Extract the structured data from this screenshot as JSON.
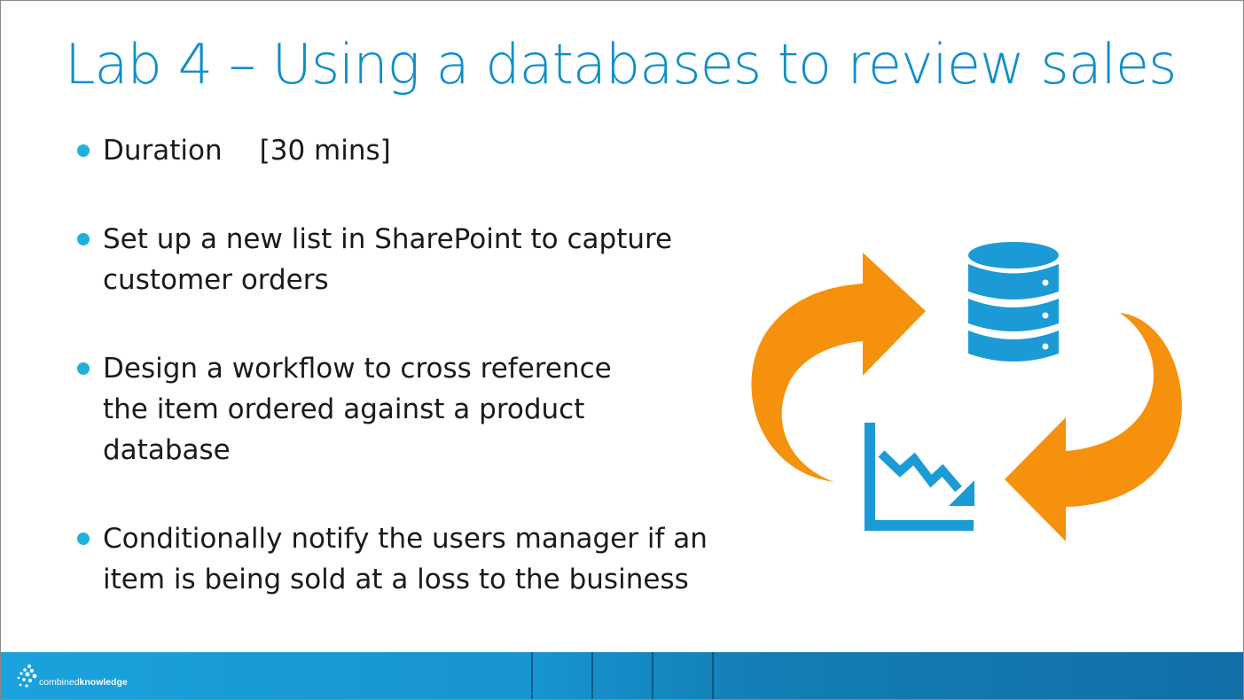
{
  "slide": {
    "title": "Lab 4 – Using a databases to review sales",
    "title_color": "#0e8ec9",
    "bullet_color": "#1fb1d9",
    "bullets": [
      {
        "label": "Duration",
        "value": "[30 mins]"
      },
      {
        "text": "Set up a new list in SharePoint to capture\ncustomer orders"
      },
      {
        "text": "Design a workflow to cross reference\nthe item ordered against a product\ndatabase"
      },
      {
        "text": "Conditionally notify the users manager if an\nitem is being sold at a loss to the business"
      }
    ]
  },
  "graphic": {
    "icons": [
      "circular-arrow-icon",
      "database-icon",
      "declining-chart-icon"
    ],
    "arrow_color": "#f5910d",
    "icon_color": "#1b9ad6"
  },
  "footer": {
    "logo_text_light": "combined",
    "logo_text_bold": "knowledge",
    "bar_color": "#1695cf"
  }
}
